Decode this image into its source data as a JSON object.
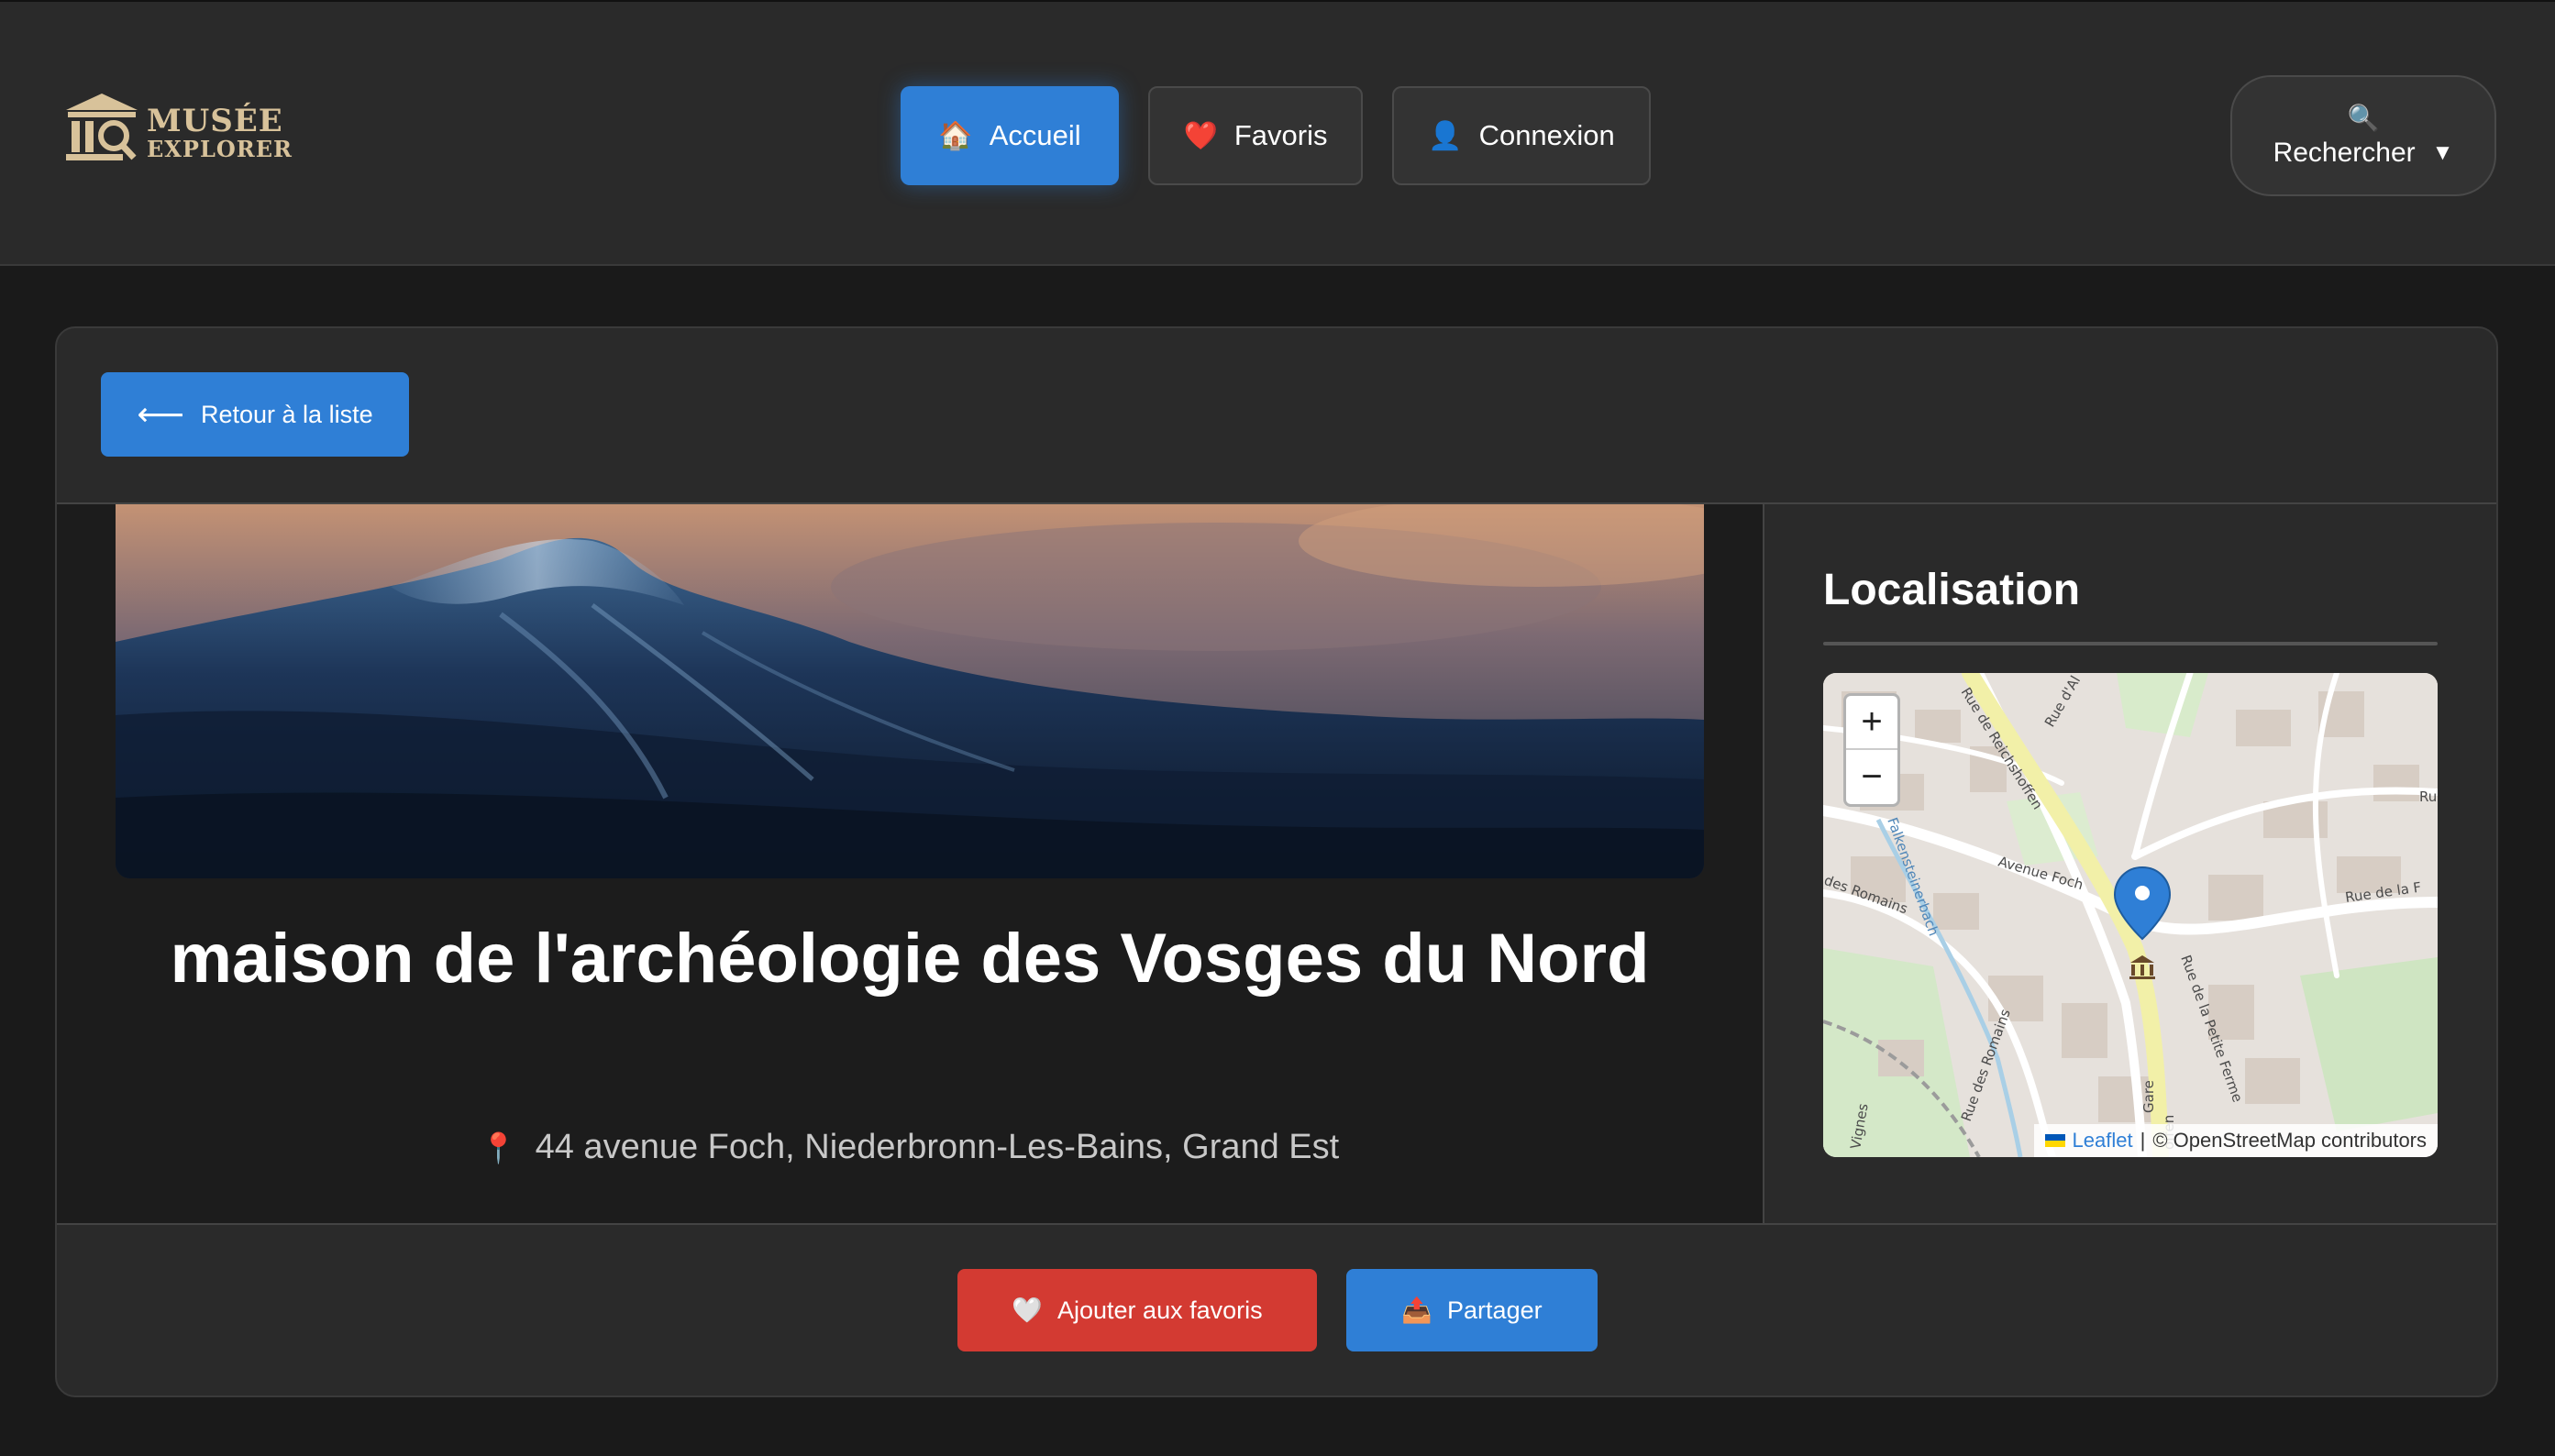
{
  "header": {
    "logo": {
      "line1": "MUSÉE",
      "line2": "EXPLORER"
    },
    "nav": [
      {
        "label": "Accueil",
        "icon": "house-icon",
        "glyph": "🏠",
        "active": true
      },
      {
        "label": "Favoris",
        "icon": "heart-icon",
        "glyph": "❤️",
        "active": false
      },
      {
        "label": "Connexion",
        "icon": "user-icon",
        "glyph": "👤",
        "active": false
      }
    ],
    "search": {
      "label": "Rechercher",
      "icon_glyph": "🔍",
      "caret": "▼"
    }
  },
  "detail": {
    "back_label": "Retour à la liste",
    "back_arrow": "⟵",
    "title": "maison de l'archéologie des Vosges du Nord",
    "address_pin": "📍",
    "address": "44 avenue Foch, Niederbronn-Les-Bains, Grand Est"
  },
  "location": {
    "title": "Localisation",
    "zoom_in": "+",
    "zoom_out": "−",
    "streets": [
      "Rue de Reichshoffen",
      "Avenue Foch",
      "Falkensteinerbach",
      "des Romains",
      "Rue de la Petite Ferme",
      "Rue de la F",
      "Rue d'Al",
      "Gare",
      "offen",
      "Rue des Romains",
      "Vignes",
      "Ru"
    ],
    "attribution": {
      "leaflet": "Leaflet",
      "separator": "|",
      "text": "© OpenStreetMap contributors"
    }
  },
  "actions": {
    "favorite": {
      "label": "Ajouter aux favoris",
      "glyph": "🤍"
    },
    "share": {
      "label": "Partager",
      "glyph": "📤"
    }
  },
  "colors": {
    "accent": "#2f7fd6",
    "danger": "#d33a32",
    "background": "#1a1a1a",
    "panel": "#2a2a2a",
    "logo_gold": "#d8c29a"
  }
}
